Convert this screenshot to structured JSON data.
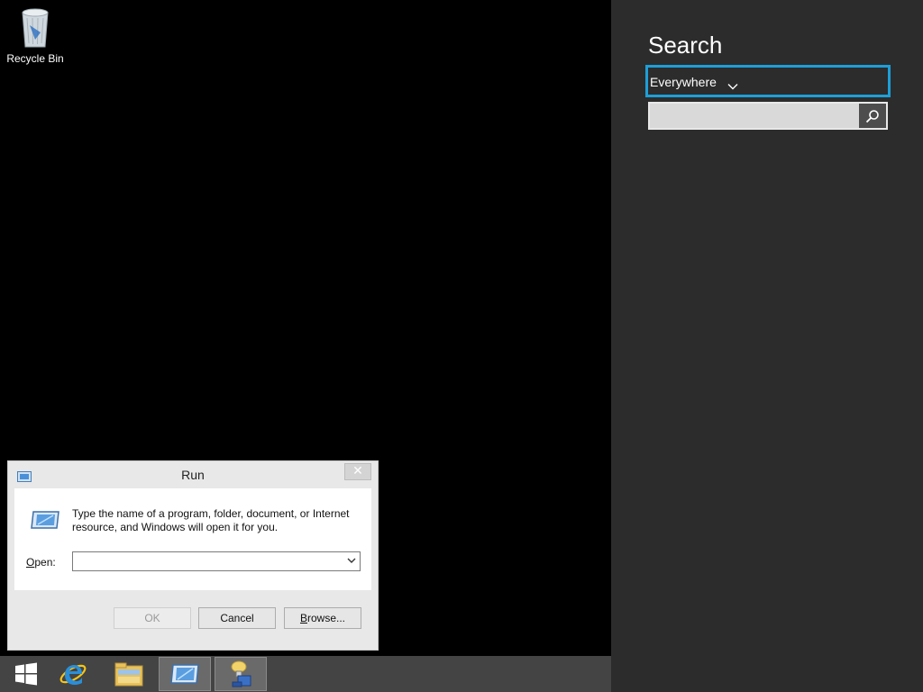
{
  "desktop": {
    "icons": [
      {
        "label": "Recycle Bin",
        "icon": "recycle-bin-icon"
      }
    ]
  },
  "run_dialog": {
    "title": "Run",
    "close_glyph": "✕",
    "description": "Type the name of a program, folder, document, or Internet resource, and Windows will open it for you.",
    "open_label_accel": "O",
    "open_label_rest": "pen:",
    "open_value": "",
    "buttons": {
      "ok": "OK",
      "cancel": "Cancel",
      "browse_accel": "B",
      "browse_rest": "rowse..."
    },
    "ok_enabled": false
  },
  "taskbar": {
    "items": [
      {
        "name": "start-button",
        "icon": "windows-logo-icon",
        "active": false
      },
      {
        "name": "internet-explorer",
        "icon": "internet-explorer-icon",
        "active": false
      },
      {
        "name": "file-explorer",
        "icon": "folder-icon",
        "active": false
      },
      {
        "name": "run-dialog-task",
        "icon": "run-icon",
        "active": true
      },
      {
        "name": "server-manager",
        "icon": "server-manager-icon",
        "active": true
      }
    ]
  },
  "search_charm": {
    "title": "Search",
    "scope": "Everywhere",
    "query": "",
    "accent_color": "#1e9fd8"
  }
}
